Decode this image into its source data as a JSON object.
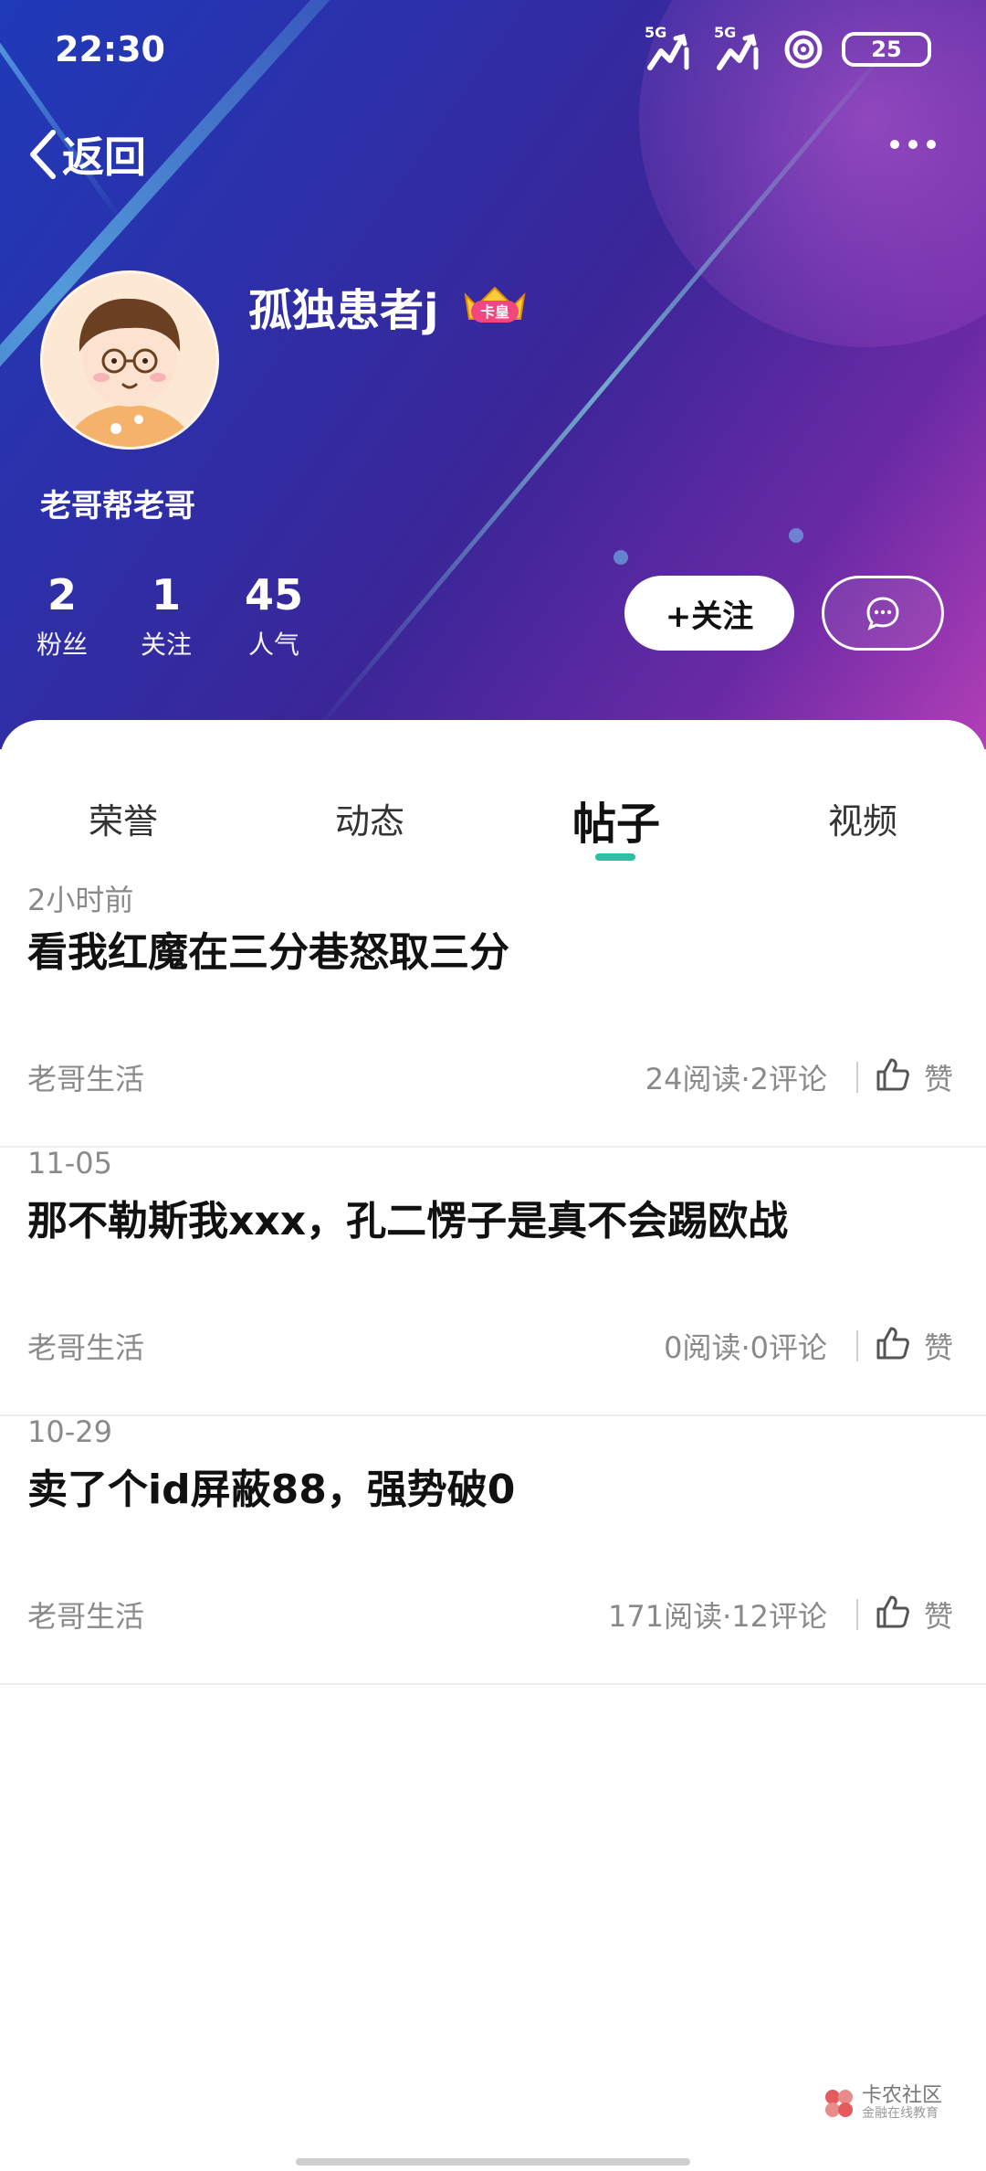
{
  "status_bar": {
    "time": "22:30",
    "signal1_tag": "5G",
    "signal2_tag": "5G",
    "battery": "25"
  },
  "nav": {
    "back_label": "返回",
    "back_icon": "chevron-left-icon",
    "more_icon": "more-dots-icon"
  },
  "profile": {
    "username": "孤独患者j",
    "badge_text": "卡皇",
    "subtitle": "老哥帮老哥",
    "stats": [
      {
        "value": "2",
        "label": "粉丝"
      },
      {
        "value": "1",
        "label": "关注"
      },
      {
        "value": "45",
        "label": "人气"
      }
    ],
    "follow_label": "+关注",
    "message_icon": "chat-bubble-icon"
  },
  "tabs": [
    {
      "label": "荣誉",
      "active": false
    },
    {
      "label": "动态",
      "active": false
    },
    {
      "label": "帖子",
      "active": true
    },
    {
      "label": "视频",
      "active": false
    }
  ],
  "posts": [
    {
      "date": "2小时前",
      "title": "看我红魔在三分巷怒取三分",
      "category": "老哥生活",
      "stats": "24阅读·2评论",
      "like_label": "赞"
    },
    {
      "date": "11-05",
      "title": "那不勒斯我xxx，孔二愣子是真不会踢欧战",
      "category": "老哥生活",
      "stats": "0阅读·0评论",
      "like_label": "赞"
    },
    {
      "date": "10-29",
      "title": "卖了个id屏蔽88，强势破0",
      "category": "老哥生活",
      "stats": "171阅读·12评论",
      "like_label": "赞"
    }
  ],
  "watermark": {
    "name": "卡农社区",
    "tagline": "金融在线教育"
  },
  "colors": {
    "accent": "#2ebfa5",
    "header_start": "#1f3ab8",
    "header_end": "#b23fb6"
  }
}
